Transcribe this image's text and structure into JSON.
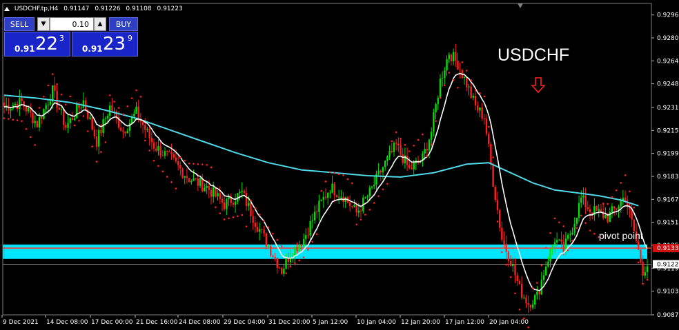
{
  "header": {
    "symbol_tf": "USDCHF.tp,H4",
    "open": "0.91147",
    "high": "0.91226",
    "low": "0.91108",
    "close": "0.91223"
  },
  "trade_panel": {
    "sell_label": "SELL",
    "buy_label": "BUY",
    "lot_value": "0.10",
    "lot_down": "▼",
    "lot_up": "▲",
    "sell_pre": "0.91",
    "sell_big": "22",
    "sell_sup": "3",
    "buy_pre": "0.91",
    "buy_big": "23",
    "buy_sup": "9"
  },
  "annotations": {
    "symbol_title": "USDCHF",
    "pivot_label": "pivot point",
    "arrow_icon": "down-arrow-icon"
  },
  "colors": {
    "background": "#000000",
    "bull_candle": "#00e000",
    "bear_candle": "#ff1e1e",
    "ma_slow": "#4fd8e8",
    "ma_fast": "#ffffff",
    "sar": "#ff2020",
    "pivot_zone": "#00e5ff",
    "pivot_line": "#ff3030",
    "price_line": "#c0c0c0"
  },
  "chart_data": {
    "type": "candlestick",
    "ylim": [
      0.9087,
      0.9304
    ],
    "y_ticks": [
      "0.92960",
      "0.92800",
      "0.92640",
      "0.92480",
      "0.92315",
      "0.92155",
      "0.91995",
      "0.91835",
      "0.91675",
      "0.91515",
      "0.91355",
      "0.91195",
      "0.91035",
      "0.90870"
    ],
    "x_ticks": [
      "9 Dec 2021",
      "14 Dec 08:00",
      "17 Dec 00:00",
      "21 Dec 16:00",
      "24 Dec 08:00",
      "29 Dec 04:00",
      "31 Dec 20:00",
      "5 Jan 12:00",
      "10 Jan 04:00",
      "12 Jan 20:00",
      "17 Jan 12:00",
      "20 Jan 04:00"
    ],
    "current_price": "0.91223",
    "red_price_tag": "0.91335",
    "pivot_zone": [
      0.9126,
      0.9136
    ],
    "pivot_line": 0.91335,
    "anchors": [
      [
        0,
        0.9232
      ],
      [
        8,
        0.9235
      ],
      [
        15,
        0.922
      ],
      [
        22,
        0.9243
      ],
      [
        28,
        0.9218
      ],
      [
        36,
        0.9236
      ],
      [
        42,
        0.9208
      ],
      [
        48,
        0.9232
      ],
      [
        54,
        0.9215
      ],
      [
        60,
        0.9228
      ],
      [
        68,
        0.9205
      ],
      [
        76,
        0.9195
      ],
      [
        84,
        0.9182
      ],
      [
        92,
        0.9176
      ],
      [
        100,
        0.9164
      ],
      [
        108,
        0.9172
      ],
      [
        114,
        0.9152
      ],
      [
        120,
        0.9135
      ],
      [
        126,
        0.9118
      ],
      [
        130,
        0.913
      ],
      [
        136,
        0.914
      ],
      [
        142,
        0.916
      ],
      [
        148,
        0.9176
      ],
      [
        154,
        0.917
      ],
      [
        160,
        0.9158
      ],
      [
        166,
        0.9172
      ],
      [
        172,
        0.919
      ],
      [
        178,
        0.9205
      ],
      [
        184,
        0.9188
      ],
      [
        190,
        0.9196
      ],
      [
        194,
        0.9215
      ],
      [
        198,
        0.925
      ],
      [
        202,
        0.927
      ],
      [
        206,
        0.9262
      ],
      [
        210,
        0.9248
      ],
      [
        214,
        0.9232
      ],
      [
        218,
        0.9225
      ],
      [
        222,
        0.918
      ],
      [
        226,
        0.914
      ],
      [
        230,
        0.9125
      ],
      [
        234,
        0.9105
      ],
      [
        238,
        0.9095
      ],
      [
        242,
        0.91
      ],
      [
        246,
        0.9122
      ],
      [
        250,
        0.914
      ],
      [
        254,
        0.9132
      ],
      [
        258,
        0.9148
      ],
      [
        262,
        0.9168
      ],
      [
        266,
        0.916
      ],
      [
        270,
        0.9158
      ],
      [
        274,
        0.9155
      ],
      [
        278,
        0.9162
      ],
      [
        282,
        0.917
      ],
      [
        286,
        0.9145
      ],
      [
        290,
        0.9118
      ],
      [
        292,
        0.9122
      ]
    ],
    "ma_slow": [
      [
        0,
        0.924
      ],
      [
        15,
        0.9238
      ],
      [
        30,
        0.9235
      ],
      [
        45,
        0.923
      ],
      [
        60,
        0.9224
      ],
      [
        75,
        0.9216
      ],
      [
        90,
        0.9208
      ],
      [
        105,
        0.92
      ],
      [
        120,
        0.9193
      ],
      [
        135,
        0.9188
      ],
      [
        150,
        0.9186
      ],
      [
        165,
        0.9184
      ],
      [
        180,
        0.9183
      ],
      [
        195,
        0.9186
      ],
      [
        210,
        0.9192
      ],
      [
        220,
        0.9193
      ],
      [
        230,
        0.9186
      ],
      [
        240,
        0.9179
      ],
      [
        250,
        0.9174
      ],
      [
        260,
        0.9172
      ],
      [
        270,
        0.917
      ],
      [
        280,
        0.9167
      ],
      [
        288,
        0.9163
      ]
    ]
  }
}
